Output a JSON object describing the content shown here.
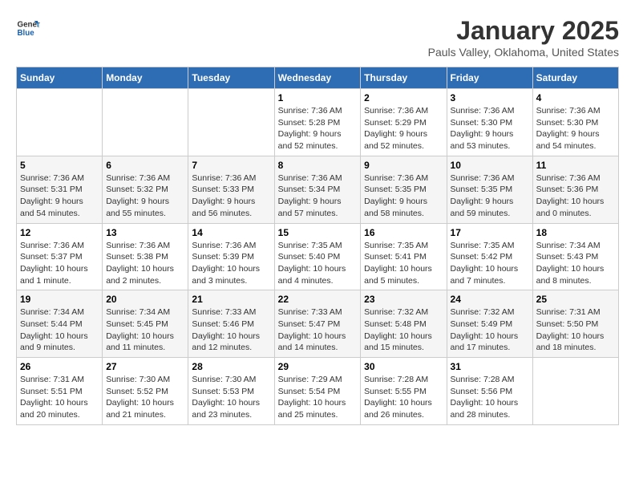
{
  "header": {
    "logo_line1": "General",
    "logo_line2": "Blue",
    "title": "January 2025",
    "subtitle": "Pauls Valley, Oklahoma, United States"
  },
  "days_of_week": [
    "Sunday",
    "Monday",
    "Tuesday",
    "Wednesday",
    "Thursday",
    "Friday",
    "Saturday"
  ],
  "weeks": [
    [
      {
        "day": "",
        "info": ""
      },
      {
        "day": "",
        "info": ""
      },
      {
        "day": "",
        "info": ""
      },
      {
        "day": "1",
        "info": "Sunrise: 7:36 AM\nSunset: 5:28 PM\nDaylight: 9 hours\nand 52 minutes."
      },
      {
        "day": "2",
        "info": "Sunrise: 7:36 AM\nSunset: 5:29 PM\nDaylight: 9 hours\nand 52 minutes."
      },
      {
        "day": "3",
        "info": "Sunrise: 7:36 AM\nSunset: 5:30 PM\nDaylight: 9 hours\nand 53 minutes."
      },
      {
        "day": "4",
        "info": "Sunrise: 7:36 AM\nSunset: 5:30 PM\nDaylight: 9 hours\nand 54 minutes."
      }
    ],
    [
      {
        "day": "5",
        "info": "Sunrise: 7:36 AM\nSunset: 5:31 PM\nDaylight: 9 hours\nand 54 minutes."
      },
      {
        "day": "6",
        "info": "Sunrise: 7:36 AM\nSunset: 5:32 PM\nDaylight: 9 hours\nand 55 minutes."
      },
      {
        "day": "7",
        "info": "Sunrise: 7:36 AM\nSunset: 5:33 PM\nDaylight: 9 hours\nand 56 minutes."
      },
      {
        "day": "8",
        "info": "Sunrise: 7:36 AM\nSunset: 5:34 PM\nDaylight: 9 hours\nand 57 minutes."
      },
      {
        "day": "9",
        "info": "Sunrise: 7:36 AM\nSunset: 5:35 PM\nDaylight: 9 hours\nand 58 minutes."
      },
      {
        "day": "10",
        "info": "Sunrise: 7:36 AM\nSunset: 5:35 PM\nDaylight: 9 hours\nand 59 minutes."
      },
      {
        "day": "11",
        "info": "Sunrise: 7:36 AM\nSunset: 5:36 PM\nDaylight: 10 hours\nand 0 minutes."
      }
    ],
    [
      {
        "day": "12",
        "info": "Sunrise: 7:36 AM\nSunset: 5:37 PM\nDaylight: 10 hours\nand 1 minute."
      },
      {
        "day": "13",
        "info": "Sunrise: 7:36 AM\nSunset: 5:38 PM\nDaylight: 10 hours\nand 2 minutes."
      },
      {
        "day": "14",
        "info": "Sunrise: 7:36 AM\nSunset: 5:39 PM\nDaylight: 10 hours\nand 3 minutes."
      },
      {
        "day": "15",
        "info": "Sunrise: 7:35 AM\nSunset: 5:40 PM\nDaylight: 10 hours\nand 4 minutes."
      },
      {
        "day": "16",
        "info": "Sunrise: 7:35 AM\nSunset: 5:41 PM\nDaylight: 10 hours\nand 5 minutes."
      },
      {
        "day": "17",
        "info": "Sunrise: 7:35 AM\nSunset: 5:42 PM\nDaylight: 10 hours\nand 7 minutes."
      },
      {
        "day": "18",
        "info": "Sunrise: 7:34 AM\nSunset: 5:43 PM\nDaylight: 10 hours\nand 8 minutes."
      }
    ],
    [
      {
        "day": "19",
        "info": "Sunrise: 7:34 AM\nSunset: 5:44 PM\nDaylight: 10 hours\nand 9 minutes."
      },
      {
        "day": "20",
        "info": "Sunrise: 7:34 AM\nSunset: 5:45 PM\nDaylight: 10 hours\nand 11 minutes."
      },
      {
        "day": "21",
        "info": "Sunrise: 7:33 AM\nSunset: 5:46 PM\nDaylight: 10 hours\nand 12 minutes."
      },
      {
        "day": "22",
        "info": "Sunrise: 7:33 AM\nSunset: 5:47 PM\nDaylight: 10 hours\nand 14 minutes."
      },
      {
        "day": "23",
        "info": "Sunrise: 7:32 AM\nSunset: 5:48 PM\nDaylight: 10 hours\nand 15 minutes."
      },
      {
        "day": "24",
        "info": "Sunrise: 7:32 AM\nSunset: 5:49 PM\nDaylight: 10 hours\nand 17 minutes."
      },
      {
        "day": "25",
        "info": "Sunrise: 7:31 AM\nSunset: 5:50 PM\nDaylight: 10 hours\nand 18 minutes."
      }
    ],
    [
      {
        "day": "26",
        "info": "Sunrise: 7:31 AM\nSunset: 5:51 PM\nDaylight: 10 hours\nand 20 minutes."
      },
      {
        "day": "27",
        "info": "Sunrise: 7:30 AM\nSunset: 5:52 PM\nDaylight: 10 hours\nand 21 minutes."
      },
      {
        "day": "28",
        "info": "Sunrise: 7:30 AM\nSunset: 5:53 PM\nDaylight: 10 hours\nand 23 minutes."
      },
      {
        "day": "29",
        "info": "Sunrise: 7:29 AM\nSunset: 5:54 PM\nDaylight: 10 hours\nand 25 minutes."
      },
      {
        "day": "30",
        "info": "Sunrise: 7:28 AM\nSunset: 5:55 PM\nDaylight: 10 hours\nand 26 minutes."
      },
      {
        "day": "31",
        "info": "Sunrise: 7:28 AM\nSunset: 5:56 PM\nDaylight: 10 hours\nand 28 minutes."
      },
      {
        "day": "",
        "info": ""
      }
    ]
  ]
}
